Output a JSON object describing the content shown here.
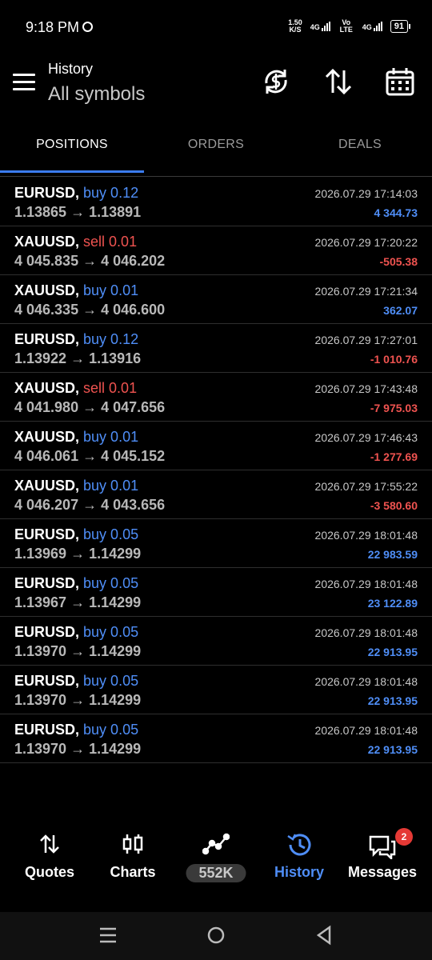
{
  "status": {
    "time": "9:18 PM",
    "speed_value": "1.50",
    "speed_unit": "K/S",
    "net1": "4G",
    "volte": "Vo LTE",
    "net2": "4G",
    "battery": "91"
  },
  "header": {
    "title": "History",
    "subtitle": "All symbols"
  },
  "tabs": [
    "POSITIONS",
    "ORDERS",
    "DEALS"
  ],
  "positions": [
    {
      "symbol": "EURUSD,",
      "side": "buy 0.12",
      "type": "buy",
      "prices": "1.13865 → 1.13891",
      "time": "2026.07.29 17:14:03",
      "profit": "4 344.73"
    },
    {
      "symbol": "XAUUSD,",
      "side": "sell 0.01",
      "type": "sell",
      "prices": "4 045.835 → 4 046.202",
      "time": "2026.07.29 17:20:22",
      "profit": "-505.38"
    },
    {
      "symbol": "XAUUSD,",
      "side": "buy 0.01",
      "type": "buy",
      "prices": "4 046.335 → 4 046.600",
      "time": "2026.07.29 17:21:34",
      "profit": "362.07"
    },
    {
      "symbol": "EURUSD,",
      "side": "buy 0.12",
      "type": "buy",
      "prices": "1.13922 → 1.13916",
      "time": "2026.07.29 17:27:01",
      "profit": "-1 010.76"
    },
    {
      "symbol": "XAUUSD,",
      "side": "sell 0.01",
      "type": "sell",
      "prices": "4 041.980 → 4 047.656",
      "time": "2026.07.29 17:43:48",
      "profit": "-7 975.03"
    },
    {
      "symbol": "XAUUSD,",
      "side": "buy 0.01",
      "type": "buy",
      "prices": "4 046.061 → 4 045.152",
      "time": "2026.07.29 17:46:43",
      "profit": "-1 277.69"
    },
    {
      "symbol": "XAUUSD,",
      "side": "buy 0.01",
      "type": "buy",
      "prices": "4 046.207 → 4 043.656",
      "time": "2026.07.29 17:55:22",
      "profit": "-3 580.60"
    },
    {
      "symbol": "EURUSD,",
      "side": "buy 0.05",
      "type": "buy",
      "prices": "1.13969 → 1.14299",
      "time": "2026.07.29 18:01:48",
      "profit": "22 983.59"
    },
    {
      "symbol": "EURUSD,",
      "side": "buy 0.05",
      "type": "buy",
      "prices": "1.13967 → 1.14299",
      "time": "2026.07.29 18:01:48",
      "profit": "23 122.89"
    },
    {
      "symbol": "EURUSD,",
      "side": "buy 0.05",
      "type": "buy",
      "prices": "1.13970 → 1.14299",
      "time": "2026.07.29 18:01:48",
      "profit": "22 913.95"
    },
    {
      "symbol": "EURUSD,",
      "side": "buy 0.05",
      "type": "buy",
      "prices": "1.13970 → 1.14299",
      "time": "2026.07.29 18:01:48",
      "profit": "22 913.95"
    },
    {
      "symbol": "EURUSD,",
      "side": "buy 0.05",
      "type": "buy",
      "prices": "1.13970 → 1.14299",
      "time": "2026.07.29 18:01:48",
      "profit": "22 913.95"
    }
  ],
  "bottom_nav": {
    "quotes": "Quotes",
    "charts": "Charts",
    "trade": "552K",
    "history": "History",
    "messages": "Messages",
    "messages_badge": "2"
  },
  "colors": {
    "accent": "#4f8ef7",
    "loss": "#ef5350",
    "tab_indicator": "#3b7cf0"
  },
  "icons": [
    "menu-icon",
    "sync-currency-icon",
    "sort-icon",
    "calendar-icon",
    "quotes-arrows-icon",
    "candlestick-icon",
    "trade-line-icon",
    "history-clock-icon",
    "messages-icon",
    "recents-icon",
    "home-icon",
    "back-icon"
  ]
}
